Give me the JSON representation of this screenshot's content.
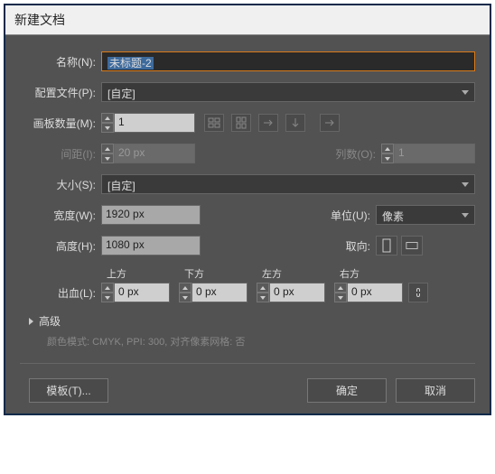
{
  "title": "新建文档",
  "name": {
    "label": "名称(N):",
    "value": "未标题-2"
  },
  "profile": {
    "label": "配置文件(P):",
    "value": "[自定]"
  },
  "artboards": {
    "label": "画板数量(M):",
    "value": "1"
  },
  "spacing": {
    "label": "间距(I):",
    "value": "20 px"
  },
  "columns": {
    "label": "列数(O):",
    "value": "1"
  },
  "size": {
    "label": "大小(S):",
    "value": "[自定]"
  },
  "width": {
    "label": "宽度(W):",
    "value": "1920 px"
  },
  "height": {
    "label": "高度(H):",
    "value": "1080 px"
  },
  "units": {
    "label": "单位(U):",
    "value": "像素"
  },
  "orientation": {
    "label": "取向:"
  },
  "bleed": {
    "label": "出血(L):",
    "top": {
      "label": "上方",
      "value": "0 px"
    },
    "bottom": {
      "label": "下方",
      "value": "0 px"
    },
    "left": {
      "label": "左方",
      "value": "0 px"
    },
    "right": {
      "label": "右方",
      "value": "0 px"
    }
  },
  "advanced": {
    "label": "高级"
  },
  "info": "颜色模式: CMYK, PPI: 300, 对齐像素网格: 否",
  "templates": {
    "label": "模板(T)..."
  },
  "ok": "确定",
  "cancel": "取消"
}
